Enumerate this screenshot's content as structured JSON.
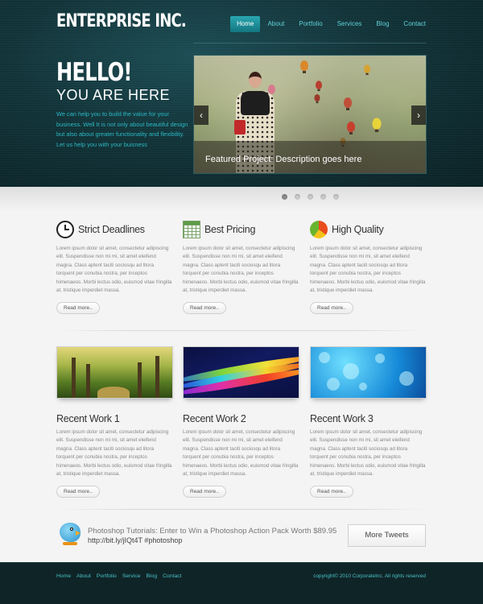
{
  "header": {
    "logo": "ENTERPRISE INC.",
    "nav": [
      "Home",
      "About",
      "Portfolio",
      "Services",
      "Blog",
      "Contact"
    ],
    "active_nav": "Home"
  },
  "hero": {
    "headline": "HELLO!",
    "subheadline": "YOU ARE HERE",
    "description": "We can help you to build the value for your business. Well It is not only about beautiful design but also about greater functionality and flexibility. Let us help you with your buisness",
    "slider_caption": "Featured Project: Description goes here",
    "prev_arrow": "‹",
    "next_arrow": "›",
    "slide_count": 5,
    "active_slide": 1
  },
  "features": [
    {
      "title": "Strict Deadlines",
      "icon": "clock-icon",
      "text": "Lorem ipsum dolor sit amet, consectetur adipiscing elit. Suspendisse non mi mi, sit amet eleifend magna. Class aptent taciti sociosqu ad litora torquent per conubia nostra, per inceptos himenaeos. Morbi lectus odio, euismod vitae fringilla at, tristique imperdiet massa.",
      "button": "Read more.."
    },
    {
      "title": "Best Pricing",
      "icon": "spreadsheet-icon",
      "text": "Lorem ipsum dolor sit amet, consectetur adipiscing elit. Suspendisse non mi mi, sit amet eleifend magna. Class aptent taciti sociosqu ad litora torquent per conubia nostra, per inceptos himenaeos. Morbi lectus odio, euismod vitae fringilla at, tristique imperdiet massa.",
      "button": "Read more.."
    },
    {
      "title": "High Quality",
      "icon": "pie-chart-icon",
      "text": "Lorem ipsum dolor sit amet, consectetur adipiscing elit. Suspendisse non mi mi, sit amet eleifend magna. Class aptent taciti sociosqu ad litora torquent per conubia nostra, per inceptos himenaeos. Morbi lectus odio, euismod vitae fringilla at, tristique imperdiet massa.",
      "button": "Read more.."
    }
  ],
  "works": [
    {
      "title": "Recent Work 1",
      "text": "Lorem ipsum dolor sit amet, consectetur adipiscing elit. Suspendisse non mi mi, sit amet eleifend magna. Class aptent taciti sociosqu ad litora torquent per conubia nostra, per inceptos himenaeos. Morbi lectus odio, euismod vitae fringilla at, tristique imperdiet massa.",
      "button": "Read more.."
    },
    {
      "title": "Recent Work 2",
      "text": "Lorem ipsum dolor sit amet, consectetur adipiscing elit. Suspendisse non mi mi, sit amet eleifend magna. Class aptent taciti sociosqu ad litora torquent per conubia nostra, per inceptos himenaeos. Morbi lectus odio, euismod vitae fringilla at, tristique imperdiet massa.",
      "button": "Read more.."
    },
    {
      "title": "Recent Work 3",
      "text": "Lorem ipsum dolor sit amet, consectetur adipiscing elit. Suspendisse non mi mi, sit amet eleifend magna. Class aptent taciti sociosqu ad litora torquent per conubia nostra, per inceptos himenaeos. Morbi lectus odio, euismod vitae fringilla at, tristique imperdiet massa.",
      "button": "Read more.."
    }
  ],
  "tweet": {
    "text": "Photoshop Tutorials: Enter to Win a Photoshop Action Pack Worth $89.95",
    "link": "http://bit.ly/jIQt4T #photoshop",
    "button": "More Tweets",
    "icon": "twitter-bird-icon"
  },
  "footer": {
    "links": [
      "Home",
      "About",
      "Portfolio",
      "Service",
      "Blog",
      "Contact"
    ],
    "copyright": "copyright© 2010 CorporateInc. All rights reserved"
  },
  "colors": {
    "accent": "#2bb8c3",
    "header_bg": "#123439",
    "footer_bg": "#0f2426"
  }
}
